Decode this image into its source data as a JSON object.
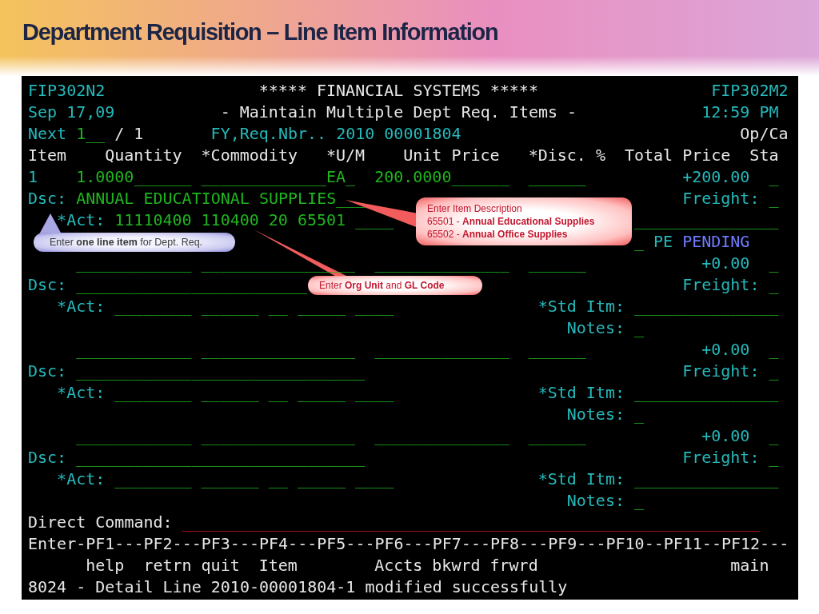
{
  "slide_title": "Department Requisition – Line Item Information",
  "screen": {
    "lines": [
      [
        {
          "text": "FIP302N2",
          "kind": "label"
        },
        {
          "text": "***** FINANCIAL SYSTEMS *****",
          "kind": "text"
        },
        {
          "text": "FIP302M2",
          "kind": "label"
        }
      ],
      [
        {
          "text": "Sep 17,09",
          "kind": "label"
        },
        {
          "text": "- Maintain Multiple Dept Req. Items -",
          "kind": "text"
        },
        {
          "text": "12:59 PM",
          "kind": "label"
        }
      ],
      [
        {
          "text": "Next",
          "kind": "label"
        },
        {
          "text": "1__",
          "kind": "input"
        },
        {
          "text": "/",
          "kind": "text"
        },
        {
          "text": "1",
          "kind": "text"
        },
        {
          "text": "FY,Req.Nbr.. 2010 00001804",
          "kind": "label"
        },
        {
          "text": "Op/Ca",
          "kind": "text"
        }
      ],
      [
        {
          "text": "Item",
          "kind": "header"
        },
        {
          "text": "Quantity",
          "kind": "header"
        },
        {
          "text": "*Commodity",
          "kind": "header"
        },
        {
          "text": "*U/M",
          "kind": "header"
        },
        {
          "text": "Unit Price",
          "kind": "header"
        },
        {
          "text": "*Disc. %",
          "kind": "header"
        },
        {
          "text": "Total Price",
          "kind": "header"
        },
        {
          "text": "Sta",
          "kind": "header"
        }
      ],
      [
        {
          "text": "1",
          "kind": "label"
        },
        {
          "text": "1.0000______",
          "kind": "input"
        },
        {
          "text": "_____________",
          "kind": "input"
        },
        {
          "text": "EA_",
          "kind": "input"
        },
        {
          "text": "200.0000______",
          "kind": "input"
        },
        {
          "text": "______",
          "kind": "input"
        },
        {
          "text": "+200.00",
          "kind": "label"
        },
        {
          "text": "_",
          "kind": "input"
        }
      ],
      [
        {
          "text": "Dsc:",
          "kind": "label"
        },
        {
          "text": "ANNUAL EDUCATIONAL SUPPLIES___",
          "kind": "input"
        },
        {
          "text": "Freight:",
          "kind": "label"
        },
        {
          "text": "_",
          "kind": "input"
        }
      ],
      [
        {
          "text": "*Act:",
          "kind": "label"
        },
        {
          "text": "11110400",
          "kind": "input"
        },
        {
          "text": "110400",
          "kind": "input"
        },
        {
          "text": "20",
          "kind": "input"
        },
        {
          "text": "65501",
          "kind": "input"
        },
        {
          "text": "____",
          "kind": "input"
        },
        {
          "text": "_______________",
          "kind": "input"
        }
      ],
      [
        {
          "text": "_",
          "kind": "input"
        },
        {
          "text": "PE",
          "kind": "label"
        },
        {
          "text": "PENDING",
          "kind": "status"
        }
      ],
      [
        {
          "text": "____________",
          "kind": "input"
        },
        {
          "text": "_____________",
          "kind": "input"
        },
        {
          "text": "___",
          "kind": "input"
        },
        {
          "text": "______________",
          "kind": "input"
        },
        {
          "text": "______",
          "kind": "input"
        },
        {
          "text": "+0.00",
          "kind": "label"
        },
        {
          "text": "_",
          "kind": "input"
        }
      ],
      [
        {
          "text": "Dsc:",
          "kind": "label"
        },
        {
          "text": "________________________",
          "kind": "input"
        },
        {
          "text": "Freight:",
          "kind": "label"
        },
        {
          "text": "_",
          "kind": "input"
        }
      ],
      [
        {
          "text": "*Act:",
          "kind": "label"
        },
        {
          "text": "________",
          "kind": "input"
        },
        {
          "text": "______",
          "kind": "input"
        },
        {
          "text": "__",
          "kind": "input"
        },
        {
          "text": "_____",
          "kind": "input"
        },
        {
          "text": "____",
          "kind": "input"
        },
        {
          "text": "*Std Itm:",
          "kind": "label"
        },
        {
          "text": "_______________",
          "kind": "input"
        }
      ],
      [
        {
          "text": "Notes:",
          "kind": "label"
        },
        {
          "text": "_",
          "kind": "input"
        }
      ],
      [
        {
          "text": "____________",
          "kind": "input"
        },
        {
          "text": "_____________",
          "kind": "input"
        },
        {
          "text": "___",
          "kind": "input"
        },
        {
          "text": "______________",
          "kind": "input"
        },
        {
          "text": "______",
          "kind": "input"
        },
        {
          "text": "+0.00",
          "kind": "label"
        },
        {
          "text": "_",
          "kind": "input"
        }
      ],
      [
        {
          "text": "Dsc:",
          "kind": "label"
        },
        {
          "text": "______________________________",
          "kind": "input"
        },
        {
          "text": "Freight:",
          "kind": "label"
        },
        {
          "text": "_",
          "kind": "input"
        }
      ],
      [
        {
          "text": "*Act:",
          "kind": "label"
        },
        {
          "text": "________",
          "kind": "input"
        },
        {
          "text": "______",
          "kind": "input"
        },
        {
          "text": "__",
          "kind": "input"
        },
        {
          "text": "_____",
          "kind": "input"
        },
        {
          "text": "____",
          "kind": "input"
        },
        {
          "text": "*Std Itm:",
          "kind": "label"
        },
        {
          "text": "_______________",
          "kind": "input"
        }
      ],
      [
        {
          "text": "Notes:",
          "kind": "label"
        },
        {
          "text": "_",
          "kind": "input"
        }
      ],
      [
        {
          "text": "____________",
          "kind": "input"
        },
        {
          "text": "_____________",
          "kind": "input"
        },
        {
          "text": "___",
          "kind": "input"
        },
        {
          "text": "______________",
          "kind": "input"
        },
        {
          "text": "______",
          "kind": "input"
        },
        {
          "text": "+0.00",
          "kind": "label"
        },
        {
          "text": "_",
          "kind": "input"
        }
      ],
      [
        {
          "text": "Dsc:",
          "kind": "label"
        },
        {
          "text": "______________________________",
          "kind": "input"
        },
        {
          "text": "Freight:",
          "kind": "label"
        },
        {
          "text": "_",
          "kind": "input"
        }
      ],
      [
        {
          "text": "*Act:",
          "kind": "label"
        },
        {
          "text": "________",
          "kind": "input"
        },
        {
          "text": "______",
          "kind": "input"
        },
        {
          "text": "__",
          "kind": "input"
        },
        {
          "text": "_____",
          "kind": "input"
        },
        {
          "text": "____",
          "kind": "input"
        },
        {
          "text": "*Std Itm:",
          "kind": "label"
        },
        {
          "text": "_______________",
          "kind": "input"
        }
      ],
      [
        {
          "text": "Notes:",
          "kind": "label"
        },
        {
          "text": "_",
          "kind": "input"
        }
      ],
      [
        {
          "text": "Direct Command:",
          "kind": "text"
        },
        {
          "text": "____________________________________________________________",
          "kind": "command"
        }
      ],
      [
        {
          "text": "Enter-PF1---PF2---PF3---PF4---PF5---PF6---PF7---PF8---PF9---PF10--PF11--PF12---",
          "kind": "text"
        }
      ],
      [
        {
          "text": "help",
          "kind": "key_label"
        },
        {
          "text": "retrn",
          "kind": "key_label"
        },
        {
          "text": "quit",
          "kind": "key_label"
        },
        {
          "text": "Item",
          "kind": "key_label"
        },
        {
          "text": "Accts",
          "kind": "key_label"
        },
        {
          "text": "bkwrd",
          "kind": "key_label"
        },
        {
          "text": "frwrd",
          "kind": "key_label"
        },
        {
          "text": "main",
          "kind": "key_label"
        }
      ],
      [
        {
          "text": "8024 - Detail Line 2010-00001804-1 modified successfully",
          "kind": "text"
        }
      ]
    ]
  },
  "callouts": [
    {
      "kind": "tip",
      "lines": [
        "Enter Item Description",
        "65501 - **Annual Educational Supplies**",
        "65502 - **Annual Office Supplies**"
      ]
    },
    {
      "kind": "note",
      "lines": [
        "Enter **one line item** for Dept. Req."
      ]
    },
    {
      "kind": "tip",
      "lines": [
        "Enter **Org Unit** and **GL Code**"
      ]
    }
  ]
}
